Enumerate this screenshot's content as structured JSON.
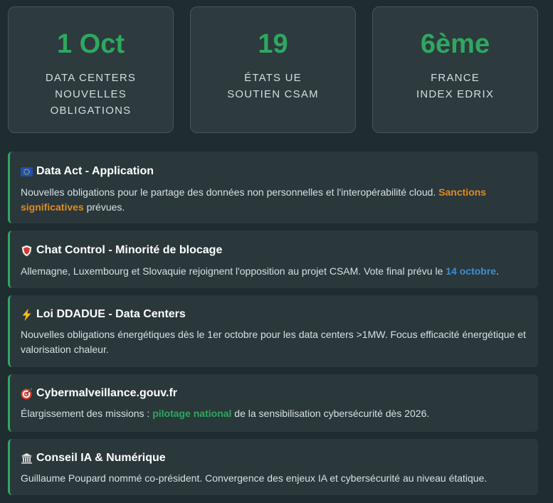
{
  "stats": [
    {
      "value": "1 Oct",
      "lines": [
        "DATA CENTERS",
        "NOUVELLES",
        "OBLIGATIONS"
      ]
    },
    {
      "value": "19",
      "lines": [
        "ÉTATS UE",
        "SOUTIEN CSAM"
      ]
    },
    {
      "value": "6ème",
      "lines": [
        "FRANCE",
        "INDEX EDRIX"
      ]
    }
  ],
  "news": [
    {
      "icon": "eu-flag-icon",
      "title": "Data Act - Application",
      "text_before": "Nouvelles obligations pour le partage des données non personnelles et l'interopérabilité cloud. ",
      "highlight": "Sanctions significatives",
      "text_after": " prévues."
    },
    {
      "icon": "shield-icon",
      "title": "Chat Control - Minorité de blocage",
      "text_before": "Allemagne, Luxembourg et Slovaquie rejoignent l'opposition au projet CSAM. Vote final prévu le ",
      "highlight": "14 octobre",
      "text_after": "."
    },
    {
      "icon": "lightning-icon",
      "title": "Loi DDADUE - Data Centers",
      "text": "Nouvelles obligations énergétiques dès le 1er octobre pour les data centers >1MW. Focus efficacité énergétique et valorisation chaleur."
    },
    {
      "icon": "target-icon",
      "title": "Cybermalveillance.gouv.fr",
      "text_before": "Élargissement des missions : ",
      "highlight": "pilotage national",
      "text_after": " de la sensibilisation cybersécurité dès 2026."
    },
    {
      "icon": "classical-building-icon",
      "title": "Conseil IA & Numérique",
      "text": "Guillaume Poupard nommé co-président. Convergence des enjeux IA et cybersécurité au niveau étatique."
    }
  ],
  "colors": {
    "accent_green": "#2ea85f",
    "highlight_orange": "#e08b22",
    "highlight_blue": "#3d8fd1"
  }
}
